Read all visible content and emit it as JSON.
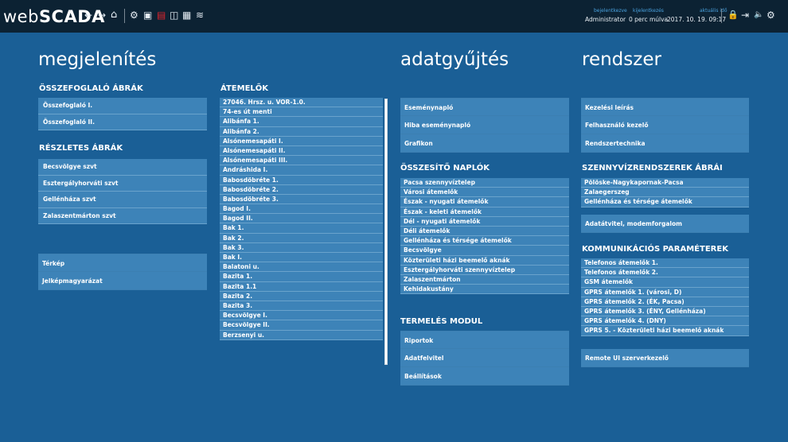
{
  "app": {
    "logo_light": "web",
    "logo_bold": "SCADA"
  },
  "toolbar": {
    "back": "←",
    "forward": "→",
    "home": "⌂",
    "icon1": "⚙",
    "icon2": "▣",
    "icon3": "▤",
    "icon4": "◫",
    "icon5": "▦",
    "icon6": "≋",
    "lock": "🔒",
    "logout": "⇥",
    "sound": "🔈",
    "settings": "⚙"
  },
  "status": {
    "login_label": "bejelentkezve",
    "login_value": "Administrator",
    "logout_label": "kijelentkezés",
    "logout_value": "0 perc múlva",
    "time_label": "aktuális idő",
    "time_value": "2017. 10. 19. 09:17"
  },
  "sections": {
    "megjelenites": "megjelenítés",
    "adatgyujtes": "adatgyűjtés",
    "rendszer": "rendszer"
  },
  "overview": {
    "title": "ÖSSZEFOGLALÓ ÁBRÁK",
    "items": [
      "Összefoglaló I.",
      "Összefoglaló II."
    ]
  },
  "details": {
    "title": "RÉSZLETES ÁBRÁK",
    "items": [
      "Becsvölgye szvt",
      "Esztergályhorváti szvt",
      "Gellénháza szvt",
      "Zalaszentmárton szvt"
    ]
  },
  "map_links": [
    "Térkép",
    "Jelképmagyarázat"
  ],
  "pumps": {
    "title": "ÁTEMELŐK",
    "items": [
      "27046. Hrsz. u. VOR-1.0.",
      "74-es út menti",
      "Alibánfa 1.",
      "Alibánfa 2.",
      "Alsónemesapáti I.",
      "Alsónemesapáti II.",
      "Alsónemesapáti III.",
      "Andráshida I.",
      "Babosdöbréte 1.",
      "Babosdöbréte 2.",
      "Babosdöbréte 3.",
      "Bagod I.",
      "Bagod II.",
      "Bak 1.",
      "Bak 2.",
      "Bak 3.",
      "Bak I.",
      "Balatoni u.",
      "Bazita 1.",
      "Bazita 1.1",
      "Bazita 2.",
      "Bazita 3.",
      "Becsvölgye I.",
      "Becsvölgye II.",
      "Berzsenyi u."
    ]
  },
  "data_links": [
    "Eseménynapló",
    "Hiba eseménynapló",
    "Grafikon"
  ],
  "summary_logs": {
    "title": "ÖSSZESÍTŐ NAPLÓK",
    "items": [
      "Pacsa szennyvíztelep",
      "Városi átemelők",
      "Észak - nyugati átemelők",
      "Észak - keleti átemelők",
      "Dél - nyugati átemelők",
      "Déli átemelők",
      "Gellénháza és térsége átemelők",
      "Becsvölgye",
      "Közterületi házi beemelő aknák",
      "Esztergályhorváti szennyvíztelep",
      "Zalaszentmárton",
      "Kehidakustány"
    ]
  },
  "production": {
    "title": "TERMELÉS MODUL",
    "items": [
      "Riportok",
      "Adatfelvitel",
      "Beállítások"
    ]
  },
  "system_links": [
    "Kezelési leírás",
    "Felhasználó kezelő",
    "Rendszertechnika"
  ],
  "sewer": {
    "title": "SZENNYVÍZRENDSZEREK ÁBRÁI",
    "items": [
      "Pölöske-Nagykapornak-Pacsa",
      "Zalaegerszeg",
      "Gellénháza és térsége átemelők"
    ]
  },
  "data_transfer": "Adatátvitel, modemforgalom",
  "comm": {
    "title": "KOMMUNIKÁCIÓS PARAMÉTEREK",
    "items": [
      "Telefonos átemelők 1.",
      "Telefonos átemelők 2.",
      "GSM átemelők",
      "GPRS átemelők 1. (városi, D)",
      "GPRS átemelők 2. (ÉK, Pacsa)",
      "GPRS átemelők 3. (ÉNY, Gellénháza)",
      "GPRS átemelők 4. (DNY)",
      "GPRS 5. - Közterületi házi beemelő aknák"
    ]
  },
  "remote_ui": "Remote UI szerverkezelő"
}
